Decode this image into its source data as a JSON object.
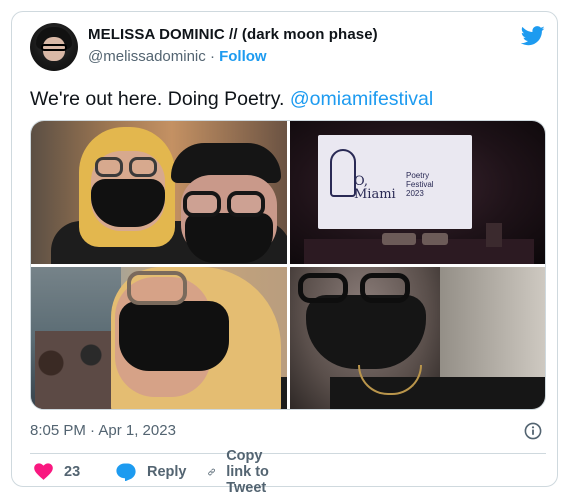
{
  "tweet": {
    "display_name": "MELISSA DOMINIC // (dark moon phase)",
    "handle": "@melissadominic",
    "separator": "·",
    "follow_label": "Follow",
    "text_plain": "We're out here. Doing Poetry. ",
    "text_mention": "@omiamifestival",
    "timestamp": "8:05 PM · Apr 1, 2023"
  },
  "media": {
    "photos": [
      {
        "name": "photo-selfie-two-women"
      },
      {
        "name": "photo-festival-screen",
        "screen_text": {
          "logo": "O,\nMiami",
          "festival": "Poetry\nFestival\n2023"
        }
      },
      {
        "name": "photo-selfie-blonde"
      },
      {
        "name": "photo-selfie-mask"
      }
    ]
  },
  "actions": {
    "like_count": "23",
    "reply_label": "Reply",
    "copy_label": "Copy link to Tweet"
  },
  "icons": {
    "brand": "twitter-bird-icon",
    "info": "info-icon",
    "like": "heart-icon",
    "reply": "reply-bubble-icon",
    "copy": "link-icon"
  },
  "colors": {
    "accent": "#1d9bf0",
    "heart": "#f91880",
    "muted": "#536471",
    "text": "#0f1419",
    "border": "#cfd9de"
  }
}
